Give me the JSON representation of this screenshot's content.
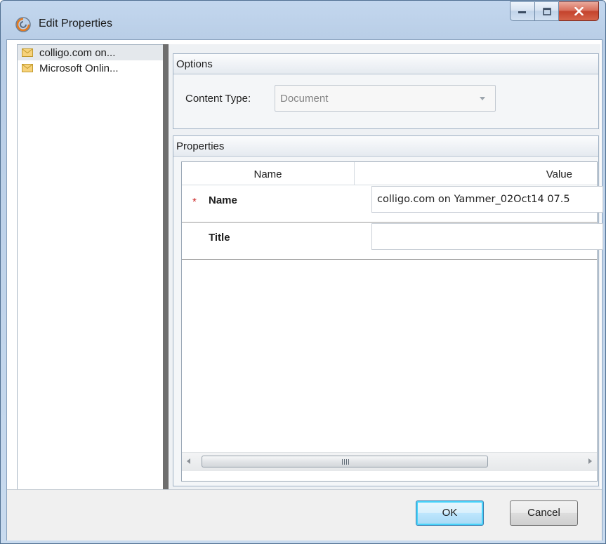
{
  "window": {
    "title": "Edit Properties",
    "controls": {
      "minimize": "minimize",
      "maximize": "maximize",
      "close": "close"
    }
  },
  "nav": {
    "items": [
      {
        "label": "colligo.com on...",
        "icon": "mail-icon",
        "selected": true
      },
      {
        "label": "Microsoft Onlin...",
        "icon": "mail-icon",
        "selected": false
      }
    ]
  },
  "options": {
    "header": "Options",
    "content_type_label": "Content Type:",
    "content_type_value": "Document"
  },
  "properties": {
    "header": "Properties",
    "columns": {
      "name": "Name",
      "value": "Value"
    },
    "rows": [
      {
        "required_mark": "*",
        "name": "Name",
        "value": "colligo.com on Yammer_02Oct14 07.5"
      },
      {
        "required_mark": "",
        "name": "Title",
        "value": ""
      }
    ],
    "scrollbar": {
      "grip": "III"
    }
  },
  "footer": {
    "ok_label": "OK",
    "cancel_label": "Cancel"
  },
  "colors": {
    "required": "#cc2929",
    "close_button": "#c4432d",
    "ok_focus": "#48d3fa"
  }
}
